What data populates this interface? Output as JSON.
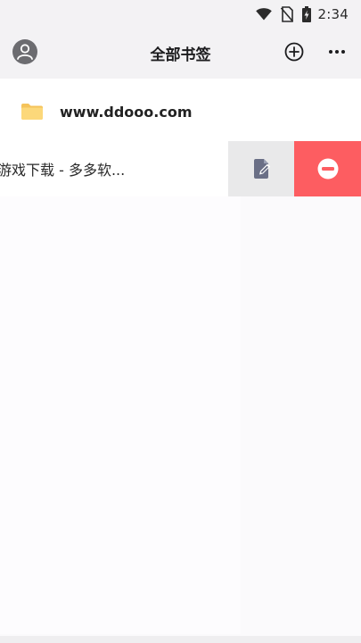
{
  "status_bar": {
    "time": "2:34",
    "icons": [
      "wifi-icon",
      "no-sim-icon",
      "battery-charging-icon"
    ]
  },
  "header": {
    "title": "全部书签",
    "left_icon": "avatar-icon",
    "right_icons": [
      "add-circle-icon",
      "more-icon"
    ]
  },
  "list": {
    "folder": {
      "icon": "folder-icon",
      "label": "www.ddooo.com"
    },
    "bookmark": {
      "label": "游戏下载 - 多多软...",
      "actions": {
        "edit_icon": "edit-icon",
        "delete_icon": "delete-icon"
      }
    }
  },
  "colors": {
    "header_bg": "#f3f2f4",
    "folder": "#fcd87a",
    "edit_bg": "#e9e9ea",
    "edit_icon": "#6a6f86",
    "delete_bg": "#fd5d61",
    "avatar": "#6c6c70"
  }
}
